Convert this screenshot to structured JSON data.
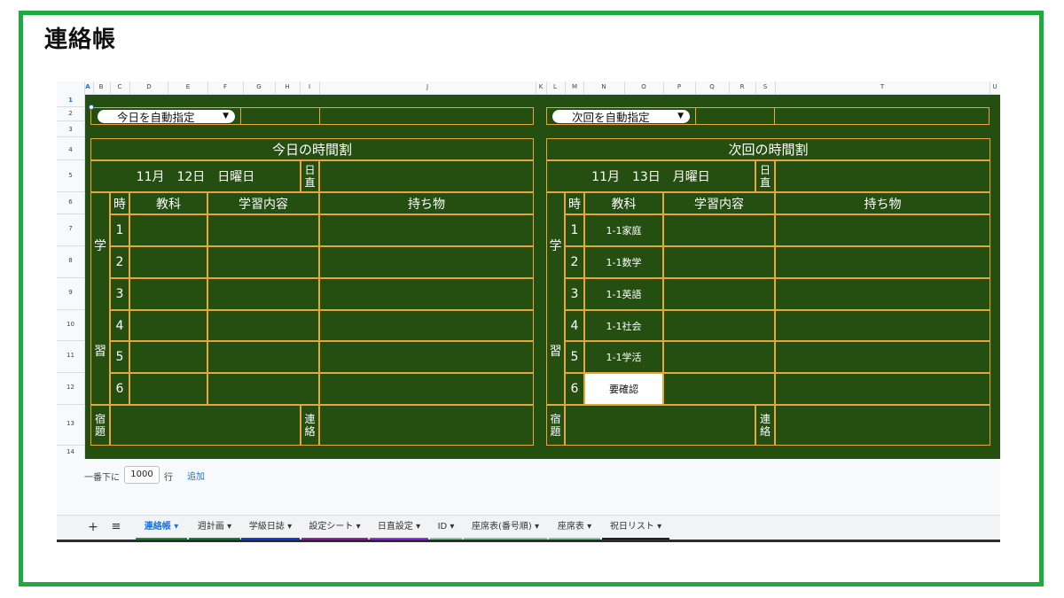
{
  "page_title": "連絡帳",
  "columns": [
    "A",
    "B",
    "C",
    "D",
    "E",
    "F",
    "G",
    "H",
    "I",
    "J",
    "K",
    "L",
    "M",
    "N",
    "O",
    "P",
    "Q",
    "R",
    "S",
    "T",
    "U"
  ],
  "rows": [
    "1",
    "2",
    "3",
    "4",
    "5",
    "6",
    "7",
    "8",
    "9",
    "10",
    "11",
    "12",
    "13",
    "14"
  ],
  "today": {
    "dropdown": "今日を自動指定",
    "title": "今日の時間割",
    "date": "11月　12日　日曜日",
    "nicchoku": "日直",
    "headers": {
      "period": "時",
      "subject": "教科",
      "content": "学習内容",
      "items": "持ち物"
    },
    "side_label_top": "学",
    "side_label_bottom": "習",
    "periods": [
      {
        "num": "1",
        "subject": ""
      },
      {
        "num": "2",
        "subject": ""
      },
      {
        "num": "3",
        "subject": ""
      },
      {
        "num": "4",
        "subject": ""
      },
      {
        "num": "5",
        "subject": ""
      },
      {
        "num": "6",
        "subject": ""
      }
    ],
    "homework_label": "宿題",
    "notice_label": "連絡"
  },
  "next": {
    "dropdown": "次回を自動指定",
    "title": "次回の時間割",
    "date": "11月　13日　月曜日",
    "nicchoku": "日直",
    "headers": {
      "period": "時",
      "subject": "教科",
      "content": "学習内容",
      "items": "持ち物"
    },
    "side_label_top": "学",
    "side_label_bottom": "習",
    "periods": [
      {
        "num": "1",
        "subject": "1-1家庭"
      },
      {
        "num": "2",
        "subject": "1-1数学"
      },
      {
        "num": "3",
        "subject": "1-1英語"
      },
      {
        "num": "4",
        "subject": "1-1社会"
      },
      {
        "num": "5",
        "subject": "1-1学活"
      },
      {
        "num": "6",
        "subject": "要確認"
      }
    ],
    "homework_label": "宿題",
    "notice_label": "連絡"
  },
  "footer": {
    "label_before": "一番下に",
    "rows_value": "1000",
    "label_after": "行",
    "add_link": "追加"
  },
  "tabs": [
    {
      "label": "連絡帳",
      "color": "#1e8e3e",
      "active": true
    },
    {
      "label": "週計画",
      "color": "#188038",
      "active": false
    },
    {
      "label": "学級日誌",
      "color": "#1a3fcf",
      "active": false
    },
    {
      "label": "設定シート",
      "color": "#8e24aa",
      "active": false
    },
    {
      "label": "日直設定",
      "color": "#9334e6",
      "active": false
    },
    {
      "label": "ID",
      "color": "#81c995",
      "active": false
    },
    {
      "label": "座席表(番号順)",
      "color": "#81c995",
      "active": false
    },
    {
      "label": "座席表",
      "color": "#81c995",
      "active": false
    },
    {
      "label": "祝日リスト",
      "color": "#202124",
      "active": false
    }
  ],
  "icons": {
    "add": "plus-icon",
    "menu": "list-icon",
    "caret": "caret-down-icon"
  },
  "colors": {
    "board": "#244f10",
    "grid": "#e7a637",
    "frame": "#1cab3f"
  }
}
